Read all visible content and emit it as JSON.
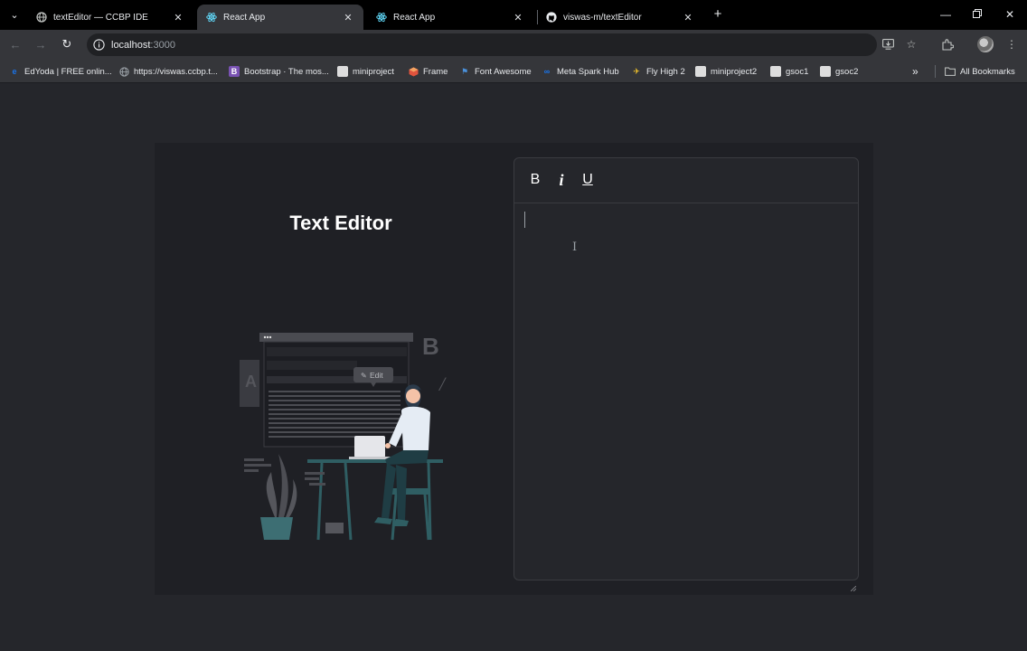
{
  "browser": {
    "tabs": [
      {
        "label": "textEditor — CCBP IDE",
        "favicon": "globe-icon",
        "active": false
      },
      {
        "label": "React App",
        "favicon": "react-icon",
        "active": true
      },
      {
        "label": "React App",
        "favicon": "react-icon",
        "active": false
      },
      {
        "label": "viswas-m/textEditor",
        "favicon": "github-icon",
        "active": false
      }
    ],
    "url_host": "localhost",
    "url_port": ":3000",
    "bookmarks": [
      {
        "label": "EdYoda | FREE onlin...",
        "icon": "edyoda-icon",
        "color": "#1a73e8"
      },
      {
        "label": "https://viswas.ccbp.t...",
        "icon": "globe-icon",
        "color": "#9aa0a6"
      },
      {
        "label": "Bootstrap · The mos...",
        "icon": "bootstrap-icon",
        "color": "#7952b3"
      },
      {
        "label": "miniproject",
        "icon": "page-icon",
        "color": "#dddddd"
      },
      {
        "label": "Frame",
        "icon": "frame-icon",
        "color": "#e0533d"
      },
      {
        "label": "Font Awesome",
        "icon": "flag-icon",
        "color": "#4a90d9"
      },
      {
        "label": "Meta Spark Hub",
        "icon": "meta-icon",
        "color": "#1877f2"
      },
      {
        "label": "Fly High 2",
        "icon": "plane-icon",
        "color": "#f9c82b"
      },
      {
        "label": "miniproject2",
        "icon": "page-icon",
        "color": "#dddddd"
      },
      {
        "label": "gsoc1",
        "icon": "page-icon",
        "color": "#dddddd"
      },
      {
        "label": "gsoc2",
        "icon": "page-icon",
        "color": "#dddddd"
      }
    ],
    "all_bookmarks": "All Bookmarks"
  },
  "app": {
    "title": "Text Editor",
    "illustration_labels": {
      "edit": "Edit",
      "bold_letter": "B",
      "a_letter": "A"
    },
    "editor": {
      "bold_label": "B",
      "italic_label": "i",
      "underline_label": "U",
      "content": ""
    }
  },
  "colors": {
    "page_bg": "#25262b",
    "card_bg": "#1f2025",
    "editor_border": "#3a3b40",
    "text": "#ffffff"
  }
}
